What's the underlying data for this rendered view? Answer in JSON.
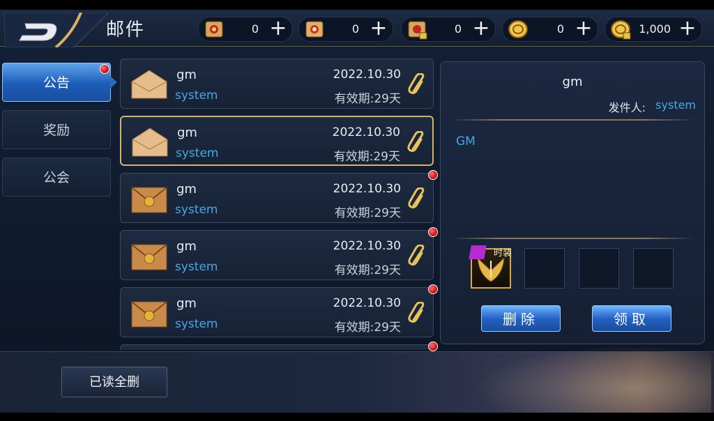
{
  "header": {
    "title": "邮件",
    "resources": [
      {
        "icon": "scroll-red-icon",
        "value": "0"
      },
      {
        "icon": "scroll-gold-icon",
        "value": "0"
      },
      {
        "icon": "scroll-lock-icon",
        "value": "0"
      },
      {
        "icon": "gold-coin-icon",
        "value": "0"
      },
      {
        "icon": "gold-coin-lock-icon",
        "value": "1,000"
      }
    ],
    "plus_label": "+"
  },
  "tabs": [
    {
      "label": "公告",
      "active": true,
      "has_dot": true
    },
    {
      "label": "奖励",
      "active": false,
      "has_dot": false
    },
    {
      "label": "公会",
      "active": false,
      "has_dot": false
    }
  ],
  "mails": [
    {
      "sender": "gm",
      "from": "system",
      "date": "2022.10.30",
      "expiry": "有效期:29天",
      "opened": true,
      "selected": false,
      "unread_dot": false
    },
    {
      "sender": "gm",
      "from": "system",
      "date": "2022.10.30",
      "expiry": "有效期:29天",
      "opened": true,
      "selected": true,
      "unread_dot": false
    },
    {
      "sender": "gm",
      "from": "system",
      "date": "2022.10.30",
      "expiry": "有效期:29天",
      "opened": false,
      "selected": false,
      "unread_dot": true
    },
    {
      "sender": "gm",
      "from": "system",
      "date": "2022.10.30",
      "expiry": "有效期:29天",
      "opened": false,
      "selected": false,
      "unread_dot": true
    },
    {
      "sender": "gm",
      "from": "system",
      "date": "2022.10.30",
      "expiry": "有效期:29天",
      "opened": false,
      "selected": false,
      "unread_dot": true
    }
  ],
  "detail": {
    "title": "gm",
    "from_label": "发件人:",
    "from": "system",
    "body": "GM",
    "attachment_label": "时装",
    "delete_label": "删除",
    "claim_label": "领取"
  },
  "footer": {
    "read_all_delete_label": "已读全删"
  },
  "colors": {
    "accent_blue": "#46a8e6",
    "selected_border": "#d4b46a",
    "unread_red": "#d11414"
  }
}
